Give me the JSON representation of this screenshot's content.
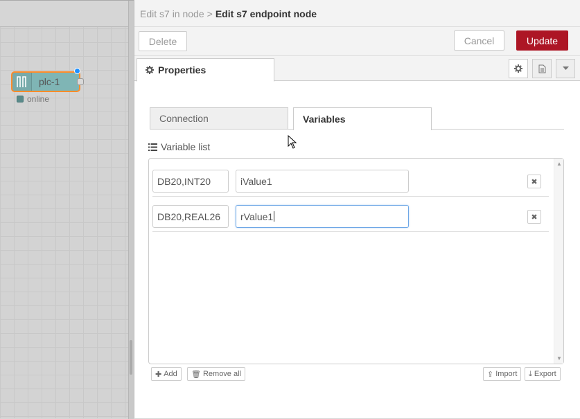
{
  "workspace": {
    "node": {
      "label": "plc-1",
      "status": "online",
      "icon": "s7-plc-icon"
    }
  },
  "tray": {
    "breadcrumb": {
      "parent": "Edit s7 in node",
      "separator": ">",
      "current": "Edit s7 endpoint node"
    },
    "toolbar": {
      "delete_label": "Delete",
      "cancel_label": "Cancel",
      "update_label": "Update"
    },
    "tabs": {
      "properties_label": "Properties"
    },
    "subtabs": {
      "connection_label": "Connection",
      "variables_label": "Variables"
    },
    "variable_list": {
      "label": "Variable list",
      "rows": [
        {
          "address": "DB20,INT20",
          "name": "iValue1"
        },
        {
          "address": "DB20,REAL26",
          "name": "rValue1"
        }
      ]
    },
    "buttons": {
      "add": "Add",
      "remove_all": "Remove all",
      "import": "Import",
      "export": "Export"
    }
  },
  "colors": {
    "accent_update": "#ad1625",
    "node_fill": "#7fb5b5",
    "node_border": "#ff8c2a",
    "changed_dot": "#1e90ff"
  }
}
